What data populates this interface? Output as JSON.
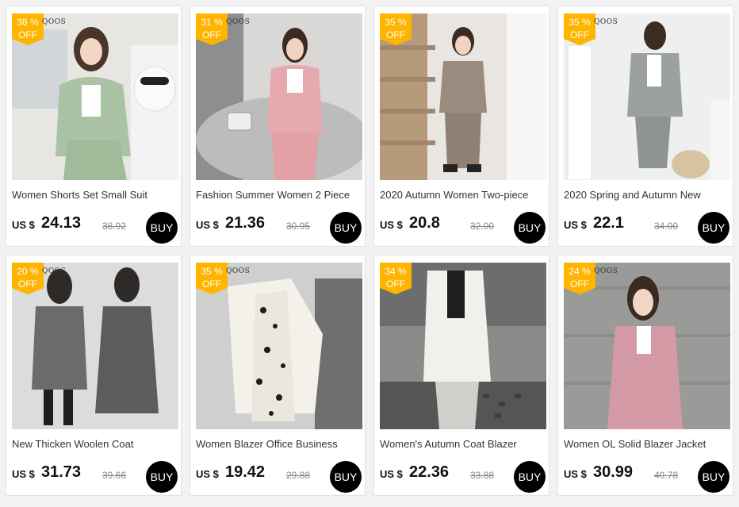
{
  "products": [
    {
      "discount_pct": "38 %",
      "discount_word": "OFF",
      "brand": "QOOS",
      "title": "Women Shorts Set Small Suit",
      "currency": "US $",
      "price": "24.13",
      "old_price": "38.92",
      "buy_label": "BUY",
      "image": "woman-green-suit-with-dog-statue"
    },
    {
      "discount_pct": "31 %",
      "discount_word": "OFF",
      "brand": "QOOS",
      "title": "Fashion Summer Women 2 Piece",
      "currency": "US $",
      "price": "21.36",
      "old_price": "30.95",
      "buy_label": "BUY",
      "image": "woman-pink-suit-on-sofa"
    },
    {
      "discount_pct": "35 %",
      "discount_word": "OFF",
      "brand": "",
      "title": "2020 Autumn Women Two-piece",
      "currency": "US $",
      "price": "20.8",
      "old_price": "32.00",
      "buy_label": "BUY",
      "image": "woman-plaid-suit-on-stairs"
    },
    {
      "discount_pct": "35 %",
      "discount_word": "OFF",
      "brand": "QOOS",
      "title": "2020 Spring and Autumn New",
      "currency": "US $",
      "price": "22.1",
      "old_price": "34.00",
      "buy_label": "BUY",
      "image": "woman-grey-plaid-suit-with-selfie"
    },
    {
      "discount_pct": "20 %",
      "discount_word": "OFF",
      "brand": "QOOS",
      "title": "New Thicken Woolen Coat",
      "currency": "US $",
      "price": "31.73",
      "old_price": "39.66",
      "buy_label": "BUY",
      "image": "two-women-plaid-coats"
    },
    {
      "discount_pct": "35 %",
      "discount_word": "OFF",
      "brand": "QOOS",
      "title": "Women Blazer Office Business",
      "currency": "US $",
      "price": "19.42",
      "old_price": "29.88",
      "buy_label": "BUY",
      "image": "white-blazer-polka-dot-dress"
    },
    {
      "discount_pct": "34 %",
      "discount_word": "OFF",
      "brand": "",
      "title": "Women's Autumn Coat Blazer",
      "currency": "US $",
      "price": "22.36",
      "old_price": "33.88",
      "buy_label": "BUY",
      "image": "woman-white-blazer-street"
    },
    {
      "discount_pct": "24 %",
      "discount_word": "OFF",
      "brand": "QOOS",
      "title": "Women OL Solid Blazer Jacket",
      "currency": "US $",
      "price": "30.99",
      "old_price": "40.78",
      "buy_label": "BUY",
      "image": "woman-pink-blazer-concrete-wall"
    }
  ],
  "colors": {
    "badge": "#ffb400",
    "buy_button": "#000000",
    "price": "#111111",
    "old_price": "#888888"
  }
}
